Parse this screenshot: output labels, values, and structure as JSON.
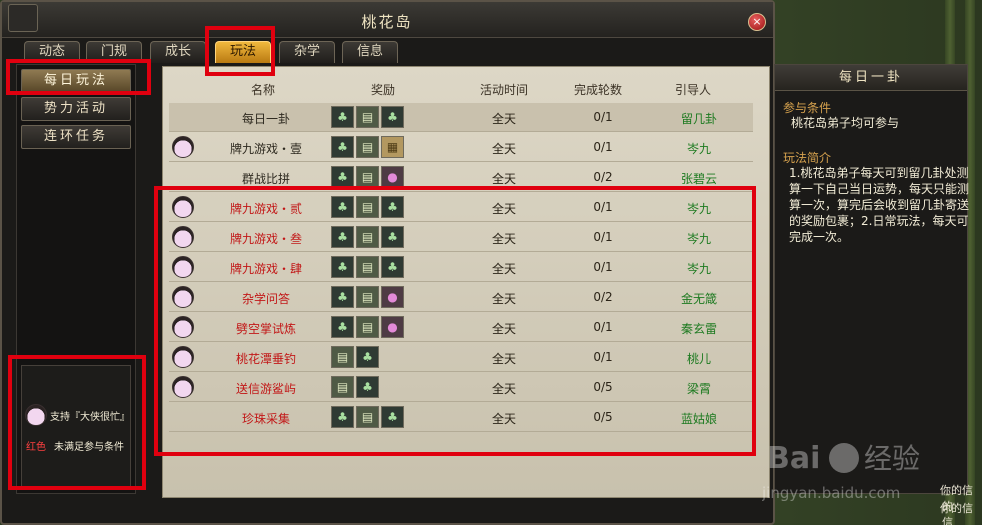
{
  "window": {
    "title": "桃花岛",
    "close": "×"
  },
  "tabs": [
    {
      "label": "动态"
    },
    {
      "label": "门规"
    },
    {
      "label": "成长"
    },
    {
      "label": "玩法"
    },
    {
      "label": "杂学"
    },
    {
      "label": "信息"
    }
  ],
  "active_tab": "玩法",
  "nav": [
    {
      "label": "每日玩法"
    },
    {
      "label": "势力活动"
    },
    {
      "label": "连环任务"
    }
  ],
  "note": {
    "support": "支持『大侠很忙』",
    "red_label": "红色",
    "red_meaning": "未满足参与条件"
  },
  "table": {
    "headers": {
      "name": "名称",
      "reward": "奖励",
      "time": "活动时间",
      "rounds": "完成轮数",
      "guide": "引导人"
    },
    "rows": [
      {
        "name": "每日一卦",
        "color": "black",
        "npc": false,
        "rewards": [
          "herb",
          "book",
          "herb"
        ],
        "time": "全天",
        "rounds": "0/1",
        "guide": "留几卦"
      },
      {
        "name": "牌九游戏・壹",
        "color": "black",
        "npc": true,
        "rewards": [
          "herb",
          "book",
          "scroll"
        ],
        "time": "全天",
        "rounds": "0/1",
        "guide": "岑九"
      },
      {
        "name": "群战比拼",
        "color": "black",
        "npc": false,
        "rewards": [
          "herb",
          "book",
          "gem"
        ],
        "time": "全天",
        "rounds": "0/2",
        "guide": "张碧云"
      },
      {
        "name": "牌九游戏・贰",
        "color": "red",
        "npc": true,
        "rewards": [
          "herb",
          "book",
          "herb"
        ],
        "time": "全天",
        "rounds": "0/1",
        "guide": "岑九"
      },
      {
        "name": "牌九游戏・叁",
        "color": "red",
        "npc": true,
        "rewards": [
          "herb",
          "book",
          "herb"
        ],
        "time": "全天",
        "rounds": "0/1",
        "guide": "岑九"
      },
      {
        "name": "牌九游戏・肆",
        "color": "red",
        "npc": true,
        "rewards": [
          "herb",
          "book",
          "herb"
        ],
        "time": "全天",
        "rounds": "0/1",
        "guide": "岑九"
      },
      {
        "name": "杂学问答",
        "color": "red",
        "npc": true,
        "rewards": [
          "herb",
          "book",
          "gem"
        ],
        "time": "全天",
        "rounds": "0/2",
        "guide": "金无箴"
      },
      {
        "name": "劈空掌试炼",
        "color": "red",
        "npc": true,
        "rewards": [
          "herb",
          "book",
          "gem"
        ],
        "time": "全天",
        "rounds": "0/1",
        "guide": "秦玄雷"
      },
      {
        "name": "桃花潭垂钓",
        "color": "red",
        "npc": true,
        "rewards": [
          "book",
          "herb"
        ],
        "time": "全天",
        "rounds": "0/1",
        "guide": "桃儿"
      },
      {
        "name": "送信游鲨屿",
        "color": "red",
        "npc": true,
        "rewards": [
          "book",
          "herb"
        ],
        "time": "全天",
        "rounds": "0/5",
        "guide": "梁霄"
      },
      {
        "name": "珍珠采集",
        "color": "red",
        "npc": false,
        "rewards": [
          "herb",
          "book",
          "herb"
        ],
        "time": "全天",
        "rounds": "0/5",
        "guide": "蓝姑娘"
      }
    ]
  },
  "info": {
    "title": "每日一卦",
    "cond_heading": "参与条件",
    "cond_text": "桃花岛弟子均可参与",
    "intro_heading": "玩法简介",
    "intro_text": "1.桃花岛弟子每天可到留几卦处测算一下自己当日运势，每天只能测算一次，算完后会收到留几卦寄送的奖励包裹；2.日常玩法，每天可完成一次。"
  },
  "background_text": {
    "a": "你的信",
    "b": "你的信"
  },
  "watermark": {
    "brand": "Bai",
    "brand_cn": "经验",
    "url": "jingyan.baidu.com"
  }
}
